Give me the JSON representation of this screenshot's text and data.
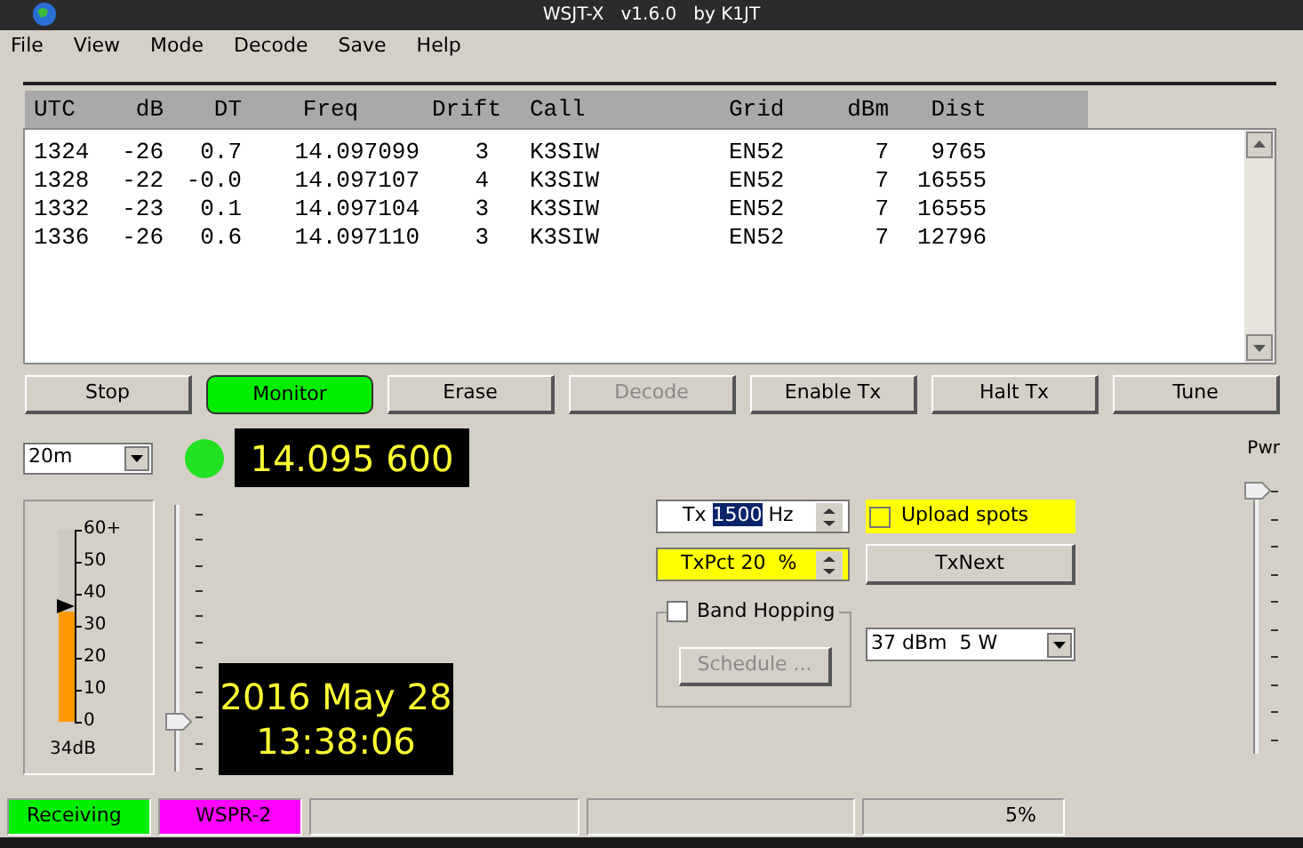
{
  "window": {
    "title": "WSJT-X   v1.6.0   by K1JT"
  },
  "menu": [
    "File",
    "View",
    "Mode",
    "Decode",
    "Save",
    "Help"
  ],
  "table": {
    "columns": [
      "UTC",
      "dB",
      "DT",
      "Freq",
      "Drift",
      "Call",
      "Grid",
      "dBm",
      "Dist"
    ],
    "rows": [
      [
        "1324",
        "-26",
        "0.7",
        "14.097099",
        "3",
        "K3SIW",
        "EN52",
        "7",
        "9765"
      ],
      [
        "1328",
        "-22",
        "-0.0",
        "14.097107",
        "4",
        "K3SIW",
        "EN52",
        "7",
        "16555"
      ],
      [
        "1332",
        "-23",
        "0.1",
        "14.097104",
        "3",
        "K3SIW",
        "EN52",
        "7",
        "16555"
      ],
      [
        "1336",
        "-26",
        "0.6",
        "14.097110",
        "3",
        "K3SIW",
        "EN52",
        "7",
        "12796"
      ]
    ]
  },
  "buttons": [
    {
      "label": "Stop",
      "on": false,
      "disabled": false
    },
    {
      "label": "Monitor",
      "on": true,
      "disabled": false
    },
    {
      "label": "Erase",
      "on": false,
      "disabled": false
    },
    {
      "label": "Decode",
      "on": false,
      "disabled": true
    },
    {
      "label": "Enable Tx",
      "on": false,
      "disabled": false
    },
    {
      "label": "Halt Tx",
      "on": false,
      "disabled": false
    },
    {
      "label": "Tune",
      "on": false,
      "disabled": false
    }
  ],
  "band": {
    "value": "20m"
  },
  "frequency": "14.095 600",
  "signal_meter": {
    "ticks": [
      "60+",
      "50",
      "40",
      "30",
      "20",
      "10",
      "0"
    ],
    "level": 0.57,
    "reading": "34dB"
  },
  "rx_slider": {
    "level": 0.2
  },
  "date": "2016 May 28",
  "time": "13:38:06",
  "tx_freq": {
    "label": "Tx",
    "value": "1500",
    "unit": "Hz"
  },
  "tx_pct": {
    "value": "TxPct 20  %"
  },
  "upload_spots": {
    "label": "Upload spots",
    "checked": false
  },
  "tx_next": "TxNext",
  "band_hopping": {
    "label": "Band Hopping",
    "checked": false,
    "schedule": {
      "label": "Schedule ...",
      "disabled": true
    }
  },
  "power_select": {
    "value": "37 dBm  5 W"
  },
  "power": {
    "label": "Pwr",
    "level": 1
  },
  "status_bar": {
    "state": "Receiving",
    "mode": "WSPR-2",
    "progress": "5%"
  }
}
